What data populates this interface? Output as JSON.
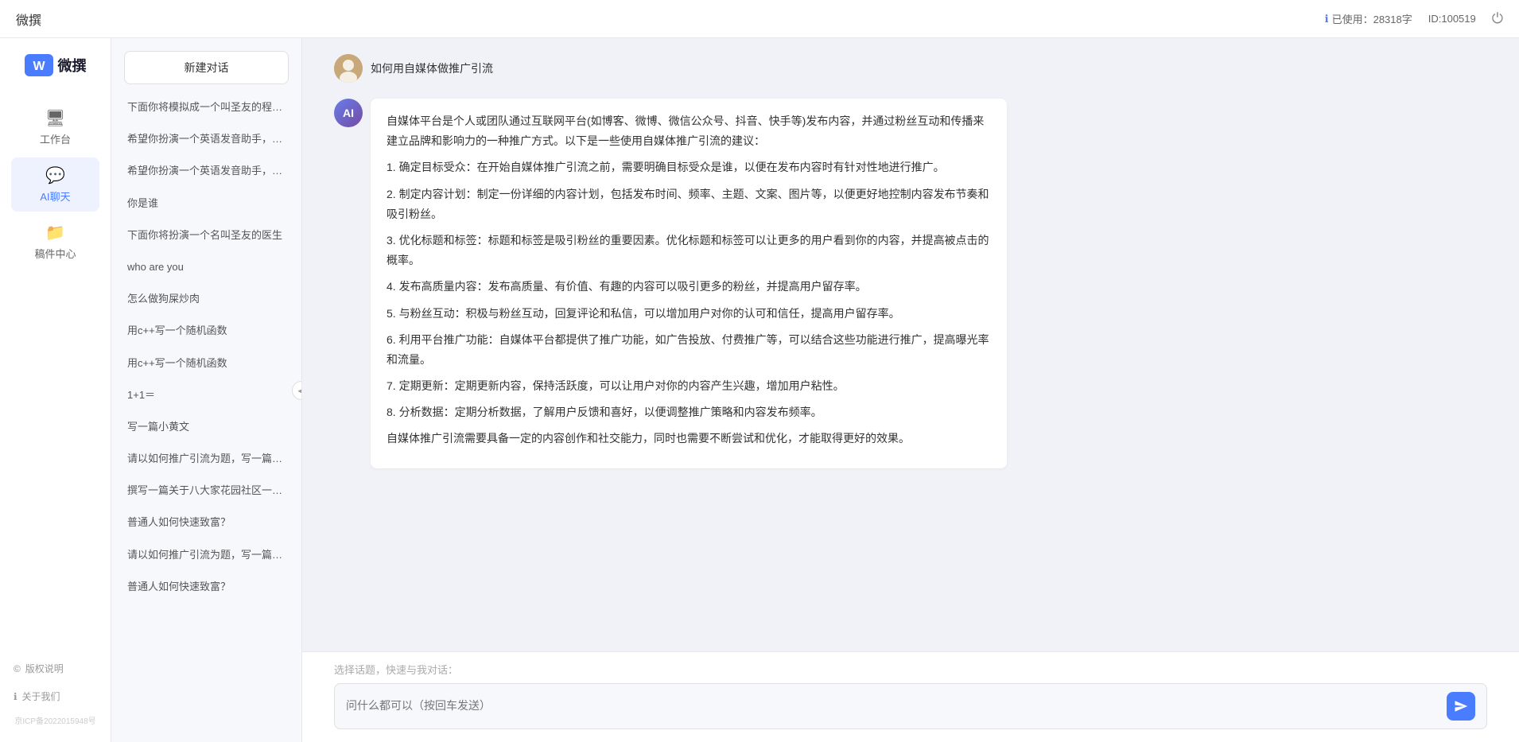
{
  "topbar": {
    "title": "微撰",
    "usage_label": "已使用：28318字",
    "id_label": "ID:100519",
    "info_icon": "ℹ",
    "power_icon": "⏻"
  },
  "logo": {
    "text": "微撰"
  },
  "nav": {
    "items": [
      {
        "id": "workbench",
        "icon": "🖥",
        "label": "工作台"
      },
      {
        "id": "ai-chat",
        "icon": "💬",
        "label": "AI聊天"
      },
      {
        "id": "drafts",
        "icon": "📁",
        "label": "稿件中心"
      }
    ],
    "bottom": [
      {
        "id": "copyright",
        "icon": "©",
        "label": "版权说明"
      },
      {
        "id": "about",
        "icon": "ℹ",
        "label": "关于我们"
      }
    ],
    "icp": "京ICP备2022015948号"
  },
  "sidebar": {
    "new_chat_label": "新建对话",
    "items": [
      {
        "text": "下面你将模拟成一个叫圣友的程序员、我说...",
        "active": false
      },
      {
        "text": "希望你扮演一个英语发音助手，我提供给你...",
        "active": false
      },
      {
        "text": "希望你扮演一个英语发音助手，我提供给你...",
        "active": false
      },
      {
        "text": "你是谁",
        "active": false
      },
      {
        "text": "下面你将扮演一个名叫圣友的医生",
        "active": false
      },
      {
        "text": "who are you",
        "active": false
      },
      {
        "text": "怎么做狗屎炒肉",
        "active": false
      },
      {
        "text": "用c++写一个随机函数",
        "active": false
      },
      {
        "text": "用c++写一个随机函数",
        "active": false
      },
      {
        "text": "1+1＝",
        "active": false
      },
      {
        "text": "写一篇小黄文",
        "active": false
      },
      {
        "text": "请以如何推广引流为题，写一篇大纲",
        "active": false
      },
      {
        "text": "撰写一篇关于八大家花园社区一刻钟便民生...",
        "active": false
      },
      {
        "text": "普通人如何快速致富？",
        "active": false
      },
      {
        "text": "请以如何推广引流为题，写一篇大纲",
        "active": false
      },
      {
        "text": "普通人如何快速致富？",
        "active": false
      }
    ]
  },
  "chat": {
    "user_question": "如何用自媒体做推广引流",
    "ai_response_paragraphs": [
      "自媒体平台是个人或团队通过互联网平台(如博客、微博、微信公众号、抖音、快手等)发布内容，并通过粉丝互动和传播来建立品牌和影响力的一种推广方式。以下是一些使用自媒体推广引流的建议：",
      "1. 确定目标受众：在开始自媒体推广引流之前，需要明确目标受众是谁，以便在发布内容时有针对性地进行推广。",
      "2. 制定内容计划：制定一份详细的内容计划，包括发布时间、频率、主题、文案、图片等，以便更好地控制内容发布节奏和吸引粉丝。",
      "3. 优化标题和标签：标题和标签是吸引粉丝的重要因素。优化标题和标签可以让更多的用户看到你的内容，并提高被点击的概率。",
      "4. 发布高质量内容：发布高质量、有价值、有趣的内容可以吸引更多的粉丝，并提高用户留存率。",
      "5. 与粉丝互动：积极与粉丝互动，回复评论和私信，可以增加用户对你的认可和信任，提高用户留存率。",
      "6. 利用平台推广功能：自媒体平台都提供了推广功能，如广告投放、付费推广等，可以结合这些功能进行推广，提高曝光率和流量。",
      "7. 定期更新：定期更新内容，保持活跃度，可以让用户对你的内容产生兴趣，增加用户粘性。",
      "8. 分析数据：定期分析数据，了解用户反馈和喜好，以便调整推广策略和内容发布频率。",
      "自媒体推广引流需要具备一定的内容创作和社交能力，同时也需要不断尝试和优化，才能取得更好的效果。"
    ]
  },
  "input": {
    "quick_label": "选择话题，快速与我对话：",
    "placeholder": "问什么都可以（按回车发送）"
  }
}
